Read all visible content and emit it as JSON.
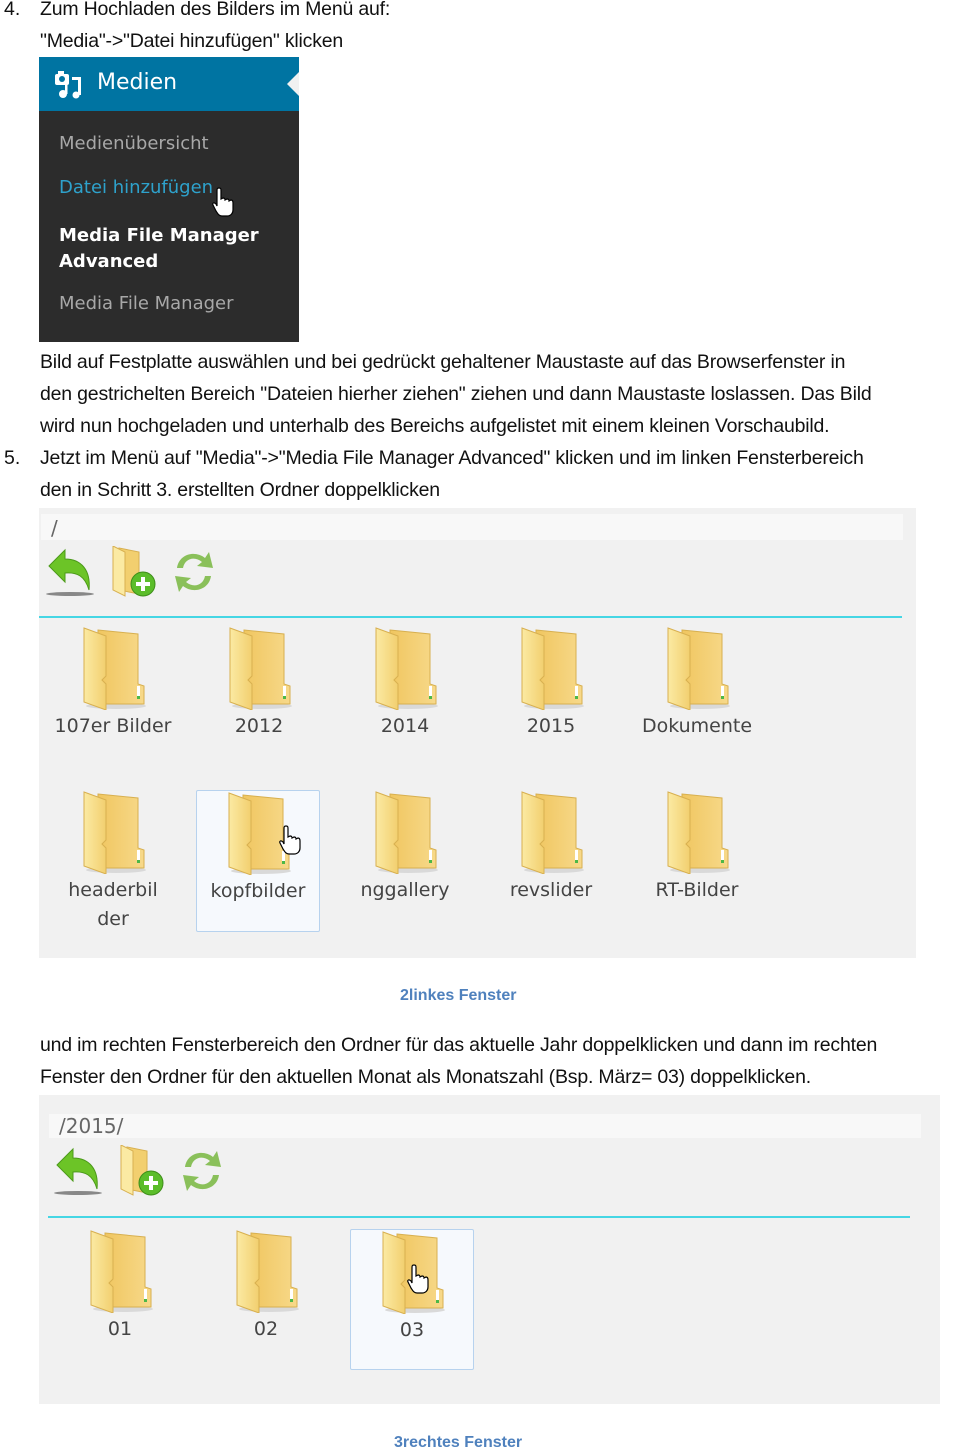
{
  "step4": {
    "number": "4.",
    "line1": "Zum Hochladen des Bilders im Menü auf:",
    "line2": "\"Media\"->\"Datei hinzufügen\" klicken"
  },
  "wp_menu": {
    "header": "Medien",
    "header_icon": "media-icon",
    "items": [
      {
        "label": "Medienübersicht",
        "state": "normal"
      },
      {
        "label": "Datei hinzufügen",
        "state": "hover"
      },
      {
        "label_line1": "Media File Manager",
        "label_line2": "Advanced",
        "state": "current"
      },
      {
        "label": "Media File Manager",
        "state": "normal"
      }
    ]
  },
  "para1": {
    "lines": [
      "Bild auf Festplatte auswählen und bei gedrückt gehaltener Maustaste auf das Browserfenster in",
      "den gestrichelten Bereich \"Dateien hierher ziehen\" ziehen und dann Maustaste loslassen. Das Bild",
      "wird nun hochgeladen und unterhalb des Bereichs aufgelistet mit einem kleinen Vorschaubild."
    ]
  },
  "step5": {
    "number": "5.",
    "line1": "Jetzt im Menü auf \"Media\"->\"Media File Manager Advanced\" klicken und im linken Fensterbereich",
    "line2": "den in Schritt 3. erstellten Ordner doppelklicken"
  },
  "left_window": {
    "path": "/",
    "toolbar": [
      "back-icon",
      "new-folder-icon",
      "refresh-icon"
    ],
    "folders": [
      "107er Bilder",
      "2012",
      "2014",
      "2015",
      "Dokumente",
      "headerbil der",
      "kopfbilder",
      "nggallery",
      "revslider",
      "RT-Bilder"
    ],
    "folder_label_headerbilder_line1": "headerbil",
    "folder_label_headerbilder_line2": "der",
    "selected": "kopfbilder",
    "caption": "2linkes Fenster"
  },
  "para2": {
    "lines": [
      "und im rechten Fensterbereich den Ordner für das aktuelle Jahr doppelklicken und dann im rechten",
      "Fenster den Ordner für den aktuellen Monat als Monatszahl (Bsp. März= 03) doppelklicken."
    ]
  },
  "right_window": {
    "path": "/2015/",
    "toolbar": [
      "back-icon",
      "new-folder-icon",
      "refresh-icon"
    ],
    "folders": [
      "01",
      "02",
      "03"
    ],
    "selected": "03",
    "caption": "3rechtes Fenster"
  },
  "colors": {
    "wp_header": "#0074a2",
    "wp_menu_bg": "#2c2c2c",
    "wp_hover": "#2ea2cc",
    "separator": "#45d6e4",
    "caption": "#4f81bd"
  }
}
